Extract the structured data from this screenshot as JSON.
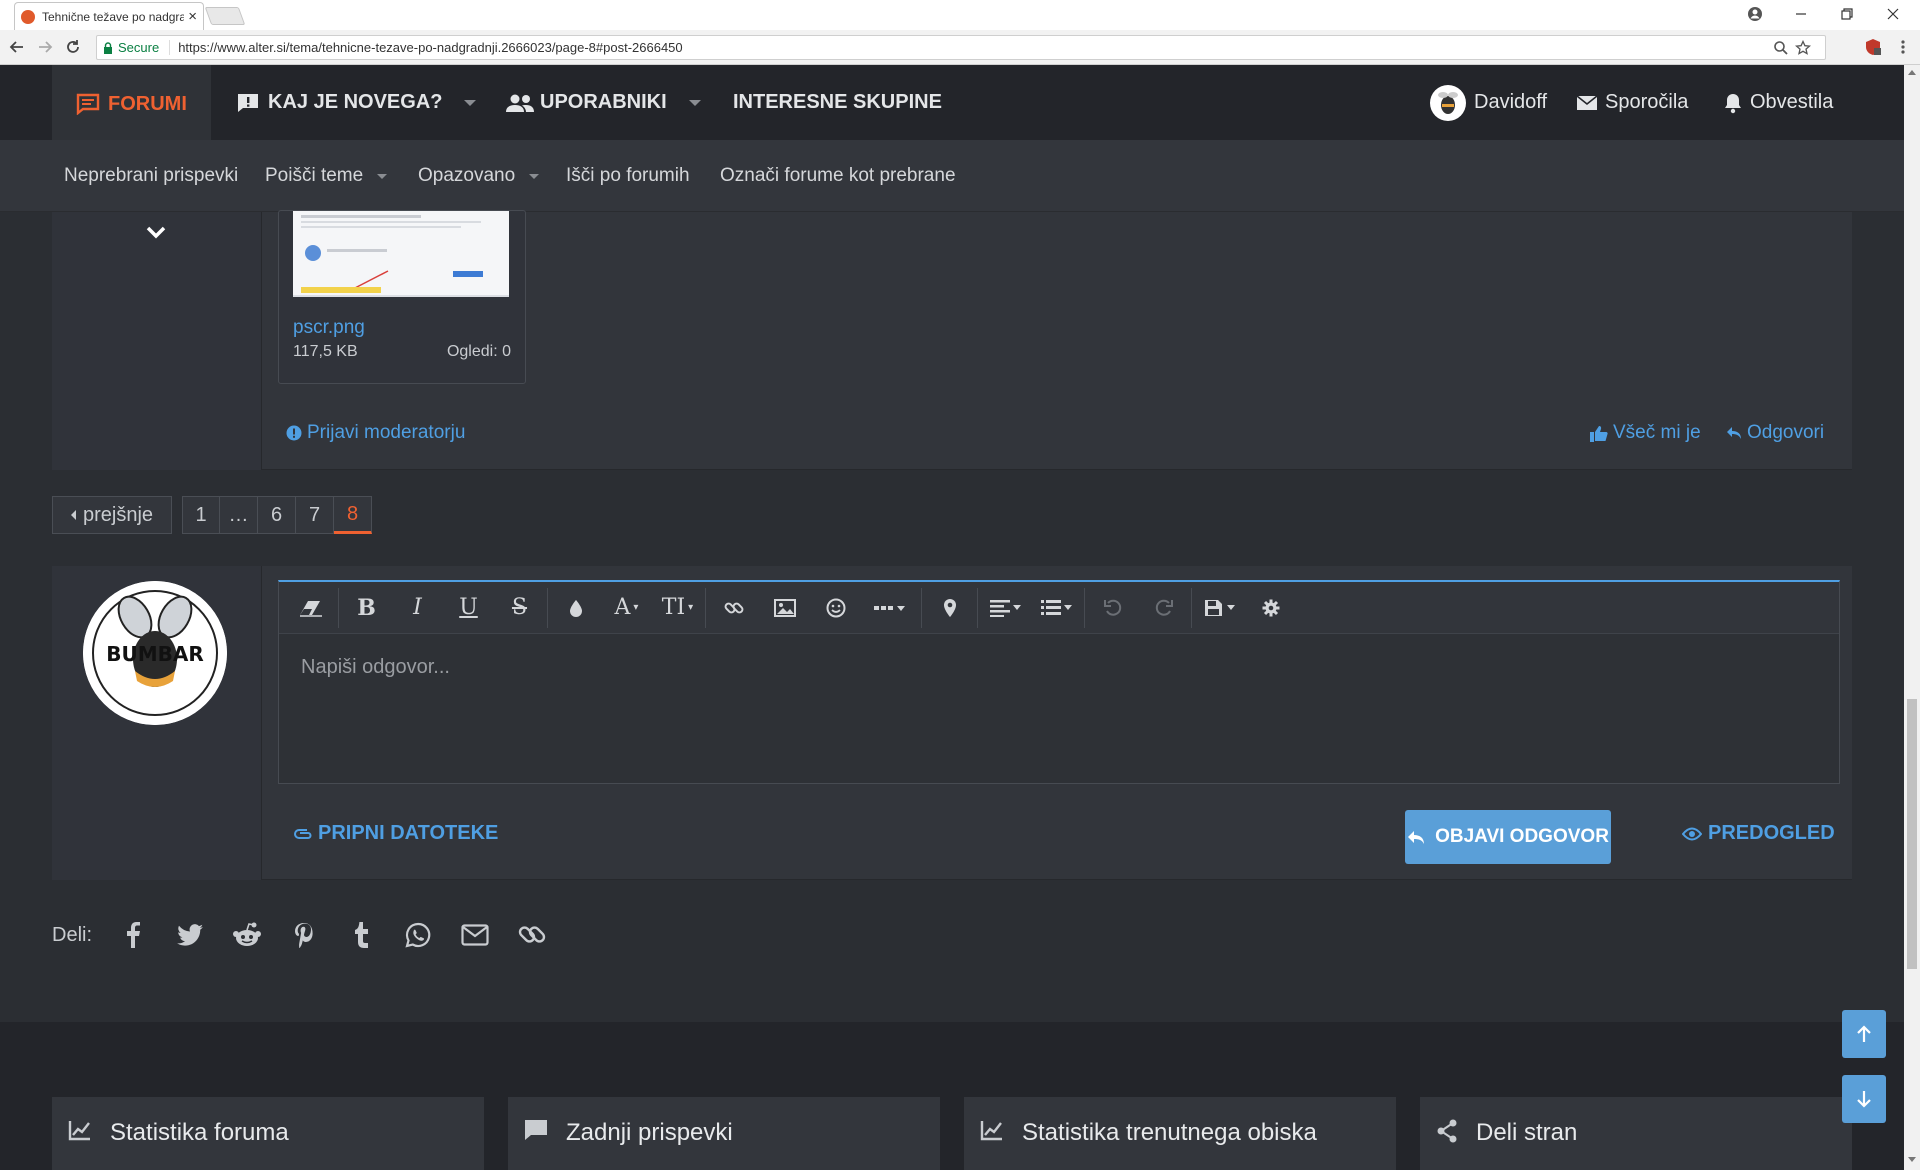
{
  "browser": {
    "tab_title": "Tehnične težave po nadgradnji",
    "tab_close": "×",
    "secure_label": "Secure",
    "url": "https://www.alter.si/tema/tehnicne-tezave-po-nadgradnji.2666023/page-8#post-2666450"
  },
  "topnav": {
    "forumi": "FORUMI",
    "kaj_je_novega": "KAJ JE NOVEGA?",
    "uporabniki": "UPORABNIKI",
    "interesne_skupine": "INTERESNE SKUPINE",
    "username": "Davidoff",
    "messages": "Sporočila",
    "alerts": "Obvestila"
  },
  "subnav": {
    "unread": "Neprebrani prispevki",
    "find_threads": "Poišči teme",
    "watched": "Opazovano",
    "search_forums": "Išči po forumih",
    "mark_read": "Označi forume kot prebrane"
  },
  "post": {
    "attachment": {
      "name": "pscr.png",
      "size": "117,5 KB",
      "views": "Ogledi: 0"
    },
    "report": "Prijavi moderatorju",
    "like": "Všeč mi je",
    "reply": "Odgovori"
  },
  "pagination": {
    "prev": "prejšnje",
    "pages": [
      "1",
      "…",
      "6",
      "7"
    ],
    "current": "8"
  },
  "reply": {
    "placeholder": "Napiši odgovor...",
    "attach_files": "PRIPNI DATOTEKE",
    "post_reply": "OBJAVI ODGOVOR",
    "preview": "PREDOGLED",
    "avatar_text": "BUMBAR"
  },
  "share": {
    "label": "Deli:",
    "icons": [
      "facebook-icon",
      "twitter-icon",
      "reddit-icon",
      "pinterest-icon",
      "tumblr-icon",
      "whatsapp-icon",
      "email-icon",
      "link-icon"
    ]
  },
  "footer": {
    "forum_stats": "Statistika foruma",
    "latest_posts": "Zadnji prispevki",
    "visit_stats": "Statistika trenutnega obiska",
    "share_page": "Deli stran"
  },
  "colors": {
    "accent_orange": "#ef6131",
    "link_blue": "#4f9fe3",
    "button_blue": "#5a9fd8"
  }
}
